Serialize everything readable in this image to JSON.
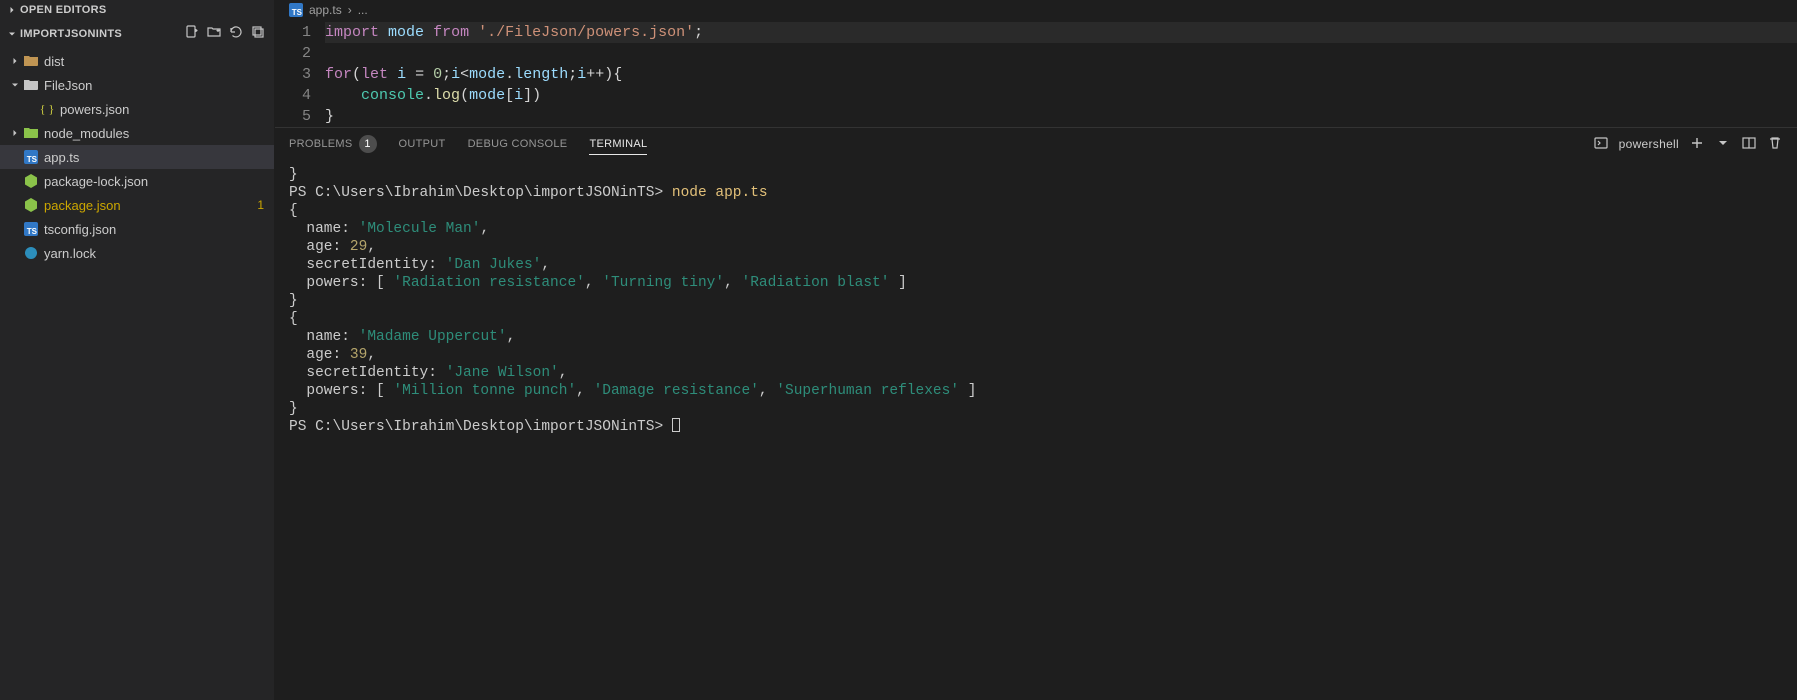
{
  "sidebar": {
    "open_editors_label": "OPEN EDITORS",
    "project_label": "IMPORTJSONINTS",
    "items": [
      {
        "type": "folder",
        "name": "dist",
        "expanded": false,
        "depth": 0,
        "icon": "folder-warm"
      },
      {
        "type": "folder",
        "name": "FileJson",
        "expanded": true,
        "depth": 0,
        "icon": "folder-plain"
      },
      {
        "type": "file",
        "name": "powers.json",
        "depth": 1,
        "icon": "json"
      },
      {
        "type": "folder",
        "name": "node_modules",
        "expanded": false,
        "depth": 0,
        "icon": "npm"
      },
      {
        "type": "file",
        "name": "app.ts",
        "depth": 0,
        "icon": "ts",
        "active": true
      },
      {
        "type": "file",
        "name": "package-lock.json",
        "depth": 0,
        "icon": "node"
      },
      {
        "type": "file",
        "name": "package.json",
        "depth": 0,
        "icon": "node",
        "modified": true,
        "badge": "1"
      },
      {
        "type": "file",
        "name": "tsconfig.json",
        "depth": 0,
        "icon": "tsconfig"
      },
      {
        "type": "file",
        "name": "yarn.lock",
        "depth": 0,
        "icon": "yarn"
      }
    ]
  },
  "breadcrumb": {
    "file": "app.ts",
    "sep": "›",
    "trail": "..."
  },
  "editor": {
    "lines": [
      {
        "n": 1,
        "tokens": [
          [
            "kw",
            "import"
          ],
          [
            "pun",
            " "
          ],
          [
            "var",
            "mode"
          ],
          [
            "pun",
            " "
          ],
          [
            "kw",
            "from"
          ],
          [
            "pun",
            " "
          ],
          [
            "str",
            "'./FileJson/powers.json'"
          ],
          [
            "pun",
            ";"
          ]
        ]
      },
      {
        "n": 2,
        "tokens": []
      },
      {
        "n": 3,
        "tokens": [
          [
            "kw",
            "for"
          ],
          [
            "pun",
            "("
          ],
          [
            "kw",
            "let"
          ],
          [
            "pun",
            " "
          ],
          [
            "var",
            "i"
          ],
          [
            "pun",
            " = "
          ],
          [
            "num",
            "0"
          ],
          [
            "pun",
            ";"
          ],
          [
            "var",
            "i"
          ],
          [
            "pun",
            "<"
          ],
          [
            "var",
            "mode"
          ],
          [
            "pun",
            "."
          ],
          [
            "var",
            "length"
          ],
          [
            "pun",
            ";"
          ],
          [
            "var",
            "i"
          ],
          [
            "pun",
            "++){"
          ]
        ]
      },
      {
        "n": 4,
        "tokens": [
          [
            "pun",
            "    "
          ],
          [
            "obj",
            "console"
          ],
          [
            "pun",
            "."
          ],
          [
            "fn",
            "log"
          ],
          [
            "pun",
            "("
          ],
          [
            "var",
            "mode"
          ],
          [
            "pun",
            "["
          ],
          [
            "var",
            "i"
          ],
          [
            "pun",
            "])"
          ]
        ]
      },
      {
        "n": 5,
        "tokens": [
          [
            "pun",
            "}"
          ]
        ]
      }
    ]
  },
  "panel": {
    "tabs": {
      "problems": "PROBLEMS",
      "problems_count": "1",
      "output": "OUTPUT",
      "debug": "DEBUG CONSOLE",
      "terminal": "TERMINAL"
    },
    "shell_label": "powershell"
  },
  "terminal": {
    "prompt_path": "PS C:\\Users\\Ibrahim\\Desktop\\importJSONinTS>",
    "command": "node app.ts",
    "obj1": {
      "name": "'Molecule Man'",
      "age": "29",
      "secret": "'Dan Jukes'",
      "powers": [
        "'Radiation resistance'",
        "'Turning tiny'",
        "'Radiation blast'"
      ]
    },
    "obj2": {
      "name": "'Madame Uppercut'",
      "age": "39",
      "secret": "'Jane Wilson'",
      "powers": [
        "'Million tonne punch'",
        "'Damage resistance'",
        "'Superhuman reflexes'"
      ]
    }
  }
}
